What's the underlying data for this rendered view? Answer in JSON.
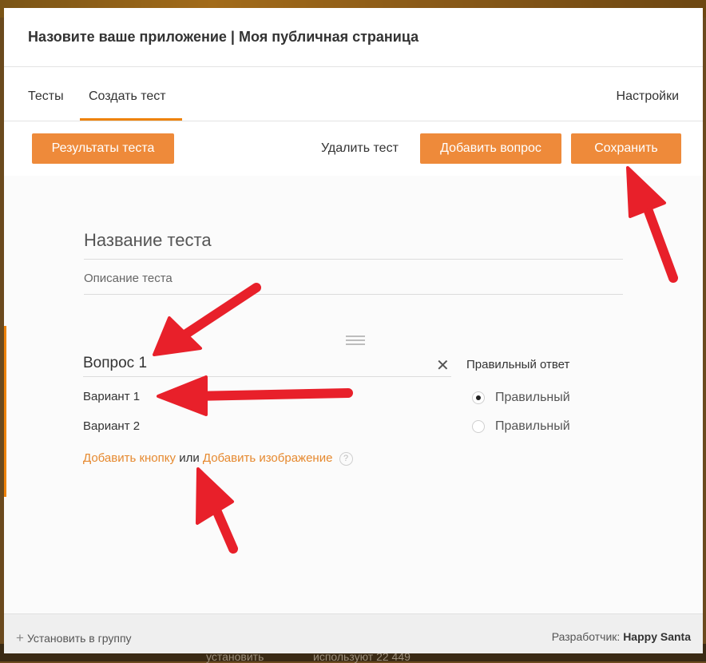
{
  "backdrop": {
    "ghost_text_1": "установить",
    "ghost_text_2": "используют 22 449"
  },
  "modal": {
    "title": "Назовите ваше приложение | Моя публичная страница"
  },
  "tabs": {
    "tests": "Тесты",
    "create_test": "Создать тест",
    "settings": "Настройки"
  },
  "toolbar": {
    "results_label": "Результаты теста",
    "delete_label": "Удалить тест",
    "add_question_label": "Добавить вопрос",
    "save_label": "Сохранить"
  },
  "form": {
    "test_title_placeholder": "Название теста",
    "test_description_placeholder": "Описание теста",
    "question_value": "Вопрос 1",
    "options": [
      "Вариант 1",
      "Вариант 2"
    ],
    "correct_answer_header": "Правильный ответ",
    "correct_labels": [
      "Правильный",
      "Правильный"
    ],
    "selected_correct_index": 0,
    "add_button_link": "Добавить кнопку",
    "or_text": "или",
    "add_image_link": "Добавить изображение",
    "help_glyph": "?"
  },
  "footer": {
    "install_label": "Установить в группу",
    "developer_prefix": "Разработчик:",
    "developer_name": "Happy Santa"
  },
  "colors": {
    "accent": "#ee8a3a",
    "annotation_arrow": "#e8202a"
  }
}
